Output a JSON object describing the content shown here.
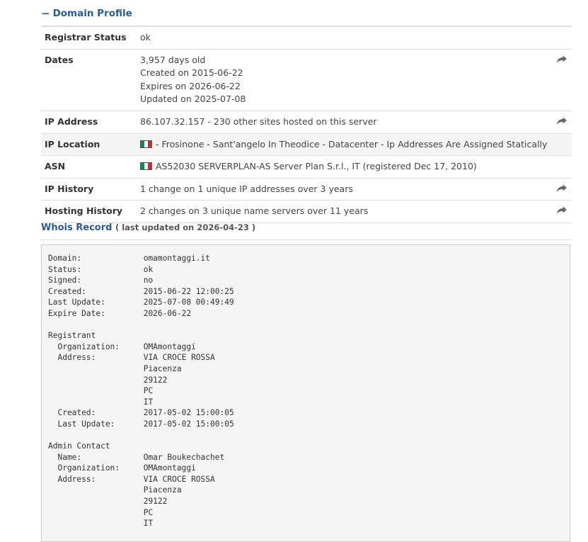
{
  "profile": {
    "title": "Domain Profile",
    "collapse_symbol": "−",
    "rows": [
      {
        "label": "Registrar Status",
        "lines": [
          "ok"
        ],
        "share": false,
        "alt": false
      },
      {
        "label": "Dates",
        "lines": [
          "3,957 days old",
          "Created on 2015-06-22",
          "Expires on 2026-06-22",
          "Updated on 2025-07-08"
        ],
        "share": true,
        "alt": false
      },
      {
        "label": "IP Address",
        "lines": [
          "86.107.32.157 - 230 other sites hosted on this server"
        ],
        "share": true,
        "alt": false
      },
      {
        "label": "IP Location",
        "lines": [
          "- Frosinone - Sant'angelo In Theodice - Datacenter - Ip Addresses Are Assigned Statically"
        ],
        "flag": true,
        "share": false,
        "alt": true
      },
      {
        "label": "ASN",
        "lines": [
          "AS52030 SERVERPLAN-AS Server Plan S.r.l., IT (registered Dec 17, 2010)"
        ],
        "flag": true,
        "share": false,
        "alt": false
      },
      {
        "label": "IP History",
        "lines": [
          "1 change on 1 unique IP addresses over 3 years"
        ],
        "share": true,
        "alt": false
      },
      {
        "label": "Hosting History",
        "lines": [
          "2 changes on 3 unique name servers over 11 years"
        ],
        "share": true,
        "alt": false
      }
    ]
  },
  "whois": {
    "title": "Whois Record",
    "updated": "( last updated on 2026-04-23 )",
    "record": "Domain:             omamontaggi.it\nStatus:             ok\nSigned:             no\nCreated:            2015-06-22 12:00:25\nLast Update:        2025-07-08 00:49:49\nExpire Date:        2026-06-22\n\nRegistrant\n  Organization:     OMAmontaggi\n  Address:          VIA CROCE ROSSA\n                    Piacenza\n                    29122\n                    PC\n                    IT\n  Created:          2017-05-02 15:00:05\n  Last Update:      2017-05-02 15:00:05\n\nAdmin Contact\n  Name:             Omar Boukechachet\n  Organization:     OMAmontaggi\n  Address:          VIA CROCE ROSSA\n                    Piacenza\n                    29122\n                    PC\n                    IT"
  },
  "colors": {
    "link": "#2a5a8e",
    "flag_green": "#009246",
    "flag_white": "#ffffff",
    "flag_red": "#ce2b37",
    "share_icon": "#666666"
  },
  "icons": {
    "share": "share-arrow-icon",
    "flag": "italy-flag-icon",
    "collapse": "minus-icon"
  }
}
